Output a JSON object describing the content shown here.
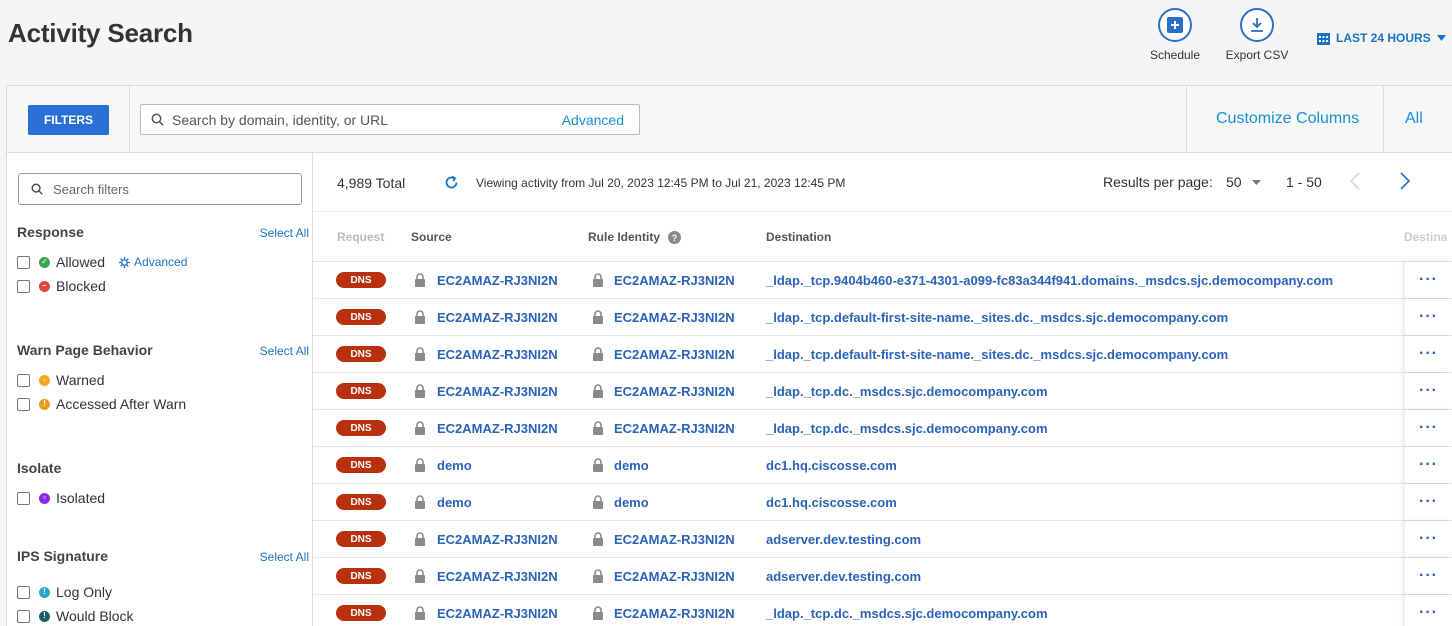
{
  "header": {
    "title": "Activity Search",
    "schedule_label": "Schedule",
    "export_label": "Export CSV",
    "time_range": "LAST 24 HOURS"
  },
  "toolbar": {
    "filters_label": "FILTERS",
    "search_placeholder": "Search by domain, identity, or URL",
    "advanced_label": "Advanced",
    "customize_label": "Customize Columns",
    "all_label": "All"
  },
  "sidebar": {
    "search_placeholder": "Search filters",
    "groups": {
      "response": {
        "title": "Response",
        "select_all": "Select All",
        "options": [
          "Allowed",
          "Blocked"
        ],
        "advanced_label": "Advanced"
      },
      "warn": {
        "title": "Warn Page Behavior",
        "select_all": "Select All",
        "options": [
          "Warned",
          "Accessed After Warn"
        ]
      },
      "isolate": {
        "title": "Isolate",
        "options": [
          "Isolated"
        ]
      },
      "ips": {
        "title": "IPS Signature",
        "select_all": "Select All",
        "options": [
          "Log Only",
          "Would Block"
        ]
      }
    }
  },
  "summary": {
    "total": "4,989 Total",
    "viewing": "Viewing activity from Jul 20, 2023 12:45 PM to Jul 21, 2023 12:45 PM",
    "results_per_page_label": "Results per page:",
    "results_per_page_value": "50",
    "range": "1 - 50"
  },
  "table": {
    "columns": [
      "Request",
      "Source",
      "Rule Identity",
      "Destination",
      "Destina"
    ],
    "rows": [
      {
        "request": "DNS",
        "source": "EC2AMAZ-RJ3NI2N",
        "rule": "EC2AMAZ-RJ3NI2N",
        "destination": "_ldap._tcp.9404b460-e371-4301-a099-fc83a344f941.domains._msdcs.sjc.democompany.com"
      },
      {
        "request": "DNS",
        "source": "EC2AMAZ-RJ3NI2N",
        "rule": "EC2AMAZ-RJ3NI2N",
        "destination": "_ldap._tcp.default-first-site-name._sites.dc._msdcs.sjc.democompany.com"
      },
      {
        "request": "DNS",
        "source": "EC2AMAZ-RJ3NI2N",
        "rule": "EC2AMAZ-RJ3NI2N",
        "destination": "_ldap._tcp.default-first-site-name._sites.dc._msdcs.sjc.democompany.com"
      },
      {
        "request": "DNS",
        "source": "EC2AMAZ-RJ3NI2N",
        "rule": "EC2AMAZ-RJ3NI2N",
        "destination": "_ldap._tcp.dc._msdcs.sjc.democompany.com"
      },
      {
        "request": "DNS",
        "source": "EC2AMAZ-RJ3NI2N",
        "rule": "EC2AMAZ-RJ3NI2N",
        "destination": "_ldap._tcp.dc._msdcs.sjc.democompany.com"
      },
      {
        "request": "DNS",
        "source": "demo",
        "rule": "demo",
        "destination": "dc1.hq.ciscosse.com"
      },
      {
        "request": "DNS",
        "source": "demo",
        "rule": "demo",
        "destination": "dc1.hq.ciscosse.com"
      },
      {
        "request": "DNS",
        "source": "EC2AMAZ-RJ3NI2N",
        "rule": "EC2AMAZ-RJ3NI2N",
        "destination": "adserver.dev.testing.com"
      },
      {
        "request": "DNS",
        "source": "EC2AMAZ-RJ3NI2N",
        "rule": "EC2AMAZ-RJ3NI2N",
        "destination": "adserver.dev.testing.com"
      },
      {
        "request": "DNS",
        "source": "EC2AMAZ-RJ3NI2N",
        "rule": "EC2AMAZ-RJ3NI2N",
        "destination": "_ldap._tcp.dc._msdcs.sjc.democompany.com"
      }
    ],
    "row_menu": "···"
  },
  "colors": {
    "accent": "#2a6fd6",
    "link": "#2a63b8",
    "dns_badge": "#b8300e",
    "allowed": "#3aa64b",
    "blocked": "#e0473a",
    "warned": "#f5a623",
    "accessed_after_warn": "#e89a1b",
    "isolated": "#8a2be2",
    "log_only": "#2aa8c4",
    "would_block": "#1e5f6b"
  }
}
